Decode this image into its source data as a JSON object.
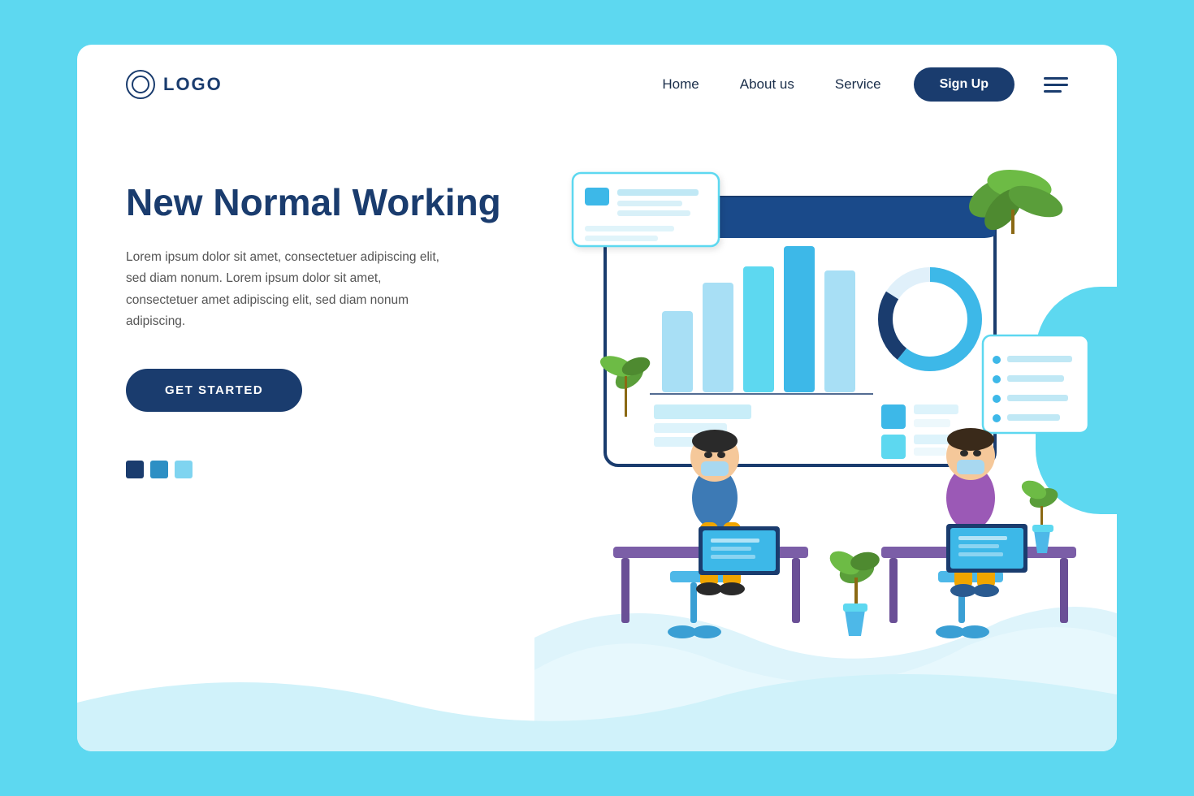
{
  "page": {
    "bg_color": "#5dd8f0",
    "card_bg": "#ffffff"
  },
  "navbar": {
    "logo_text": "LOGO",
    "links": [
      {
        "label": "Home",
        "id": "home"
      },
      {
        "label": "About us",
        "id": "about"
      },
      {
        "label": "Service",
        "id": "service"
      }
    ],
    "signup_label": "Sign Up",
    "hamburger_label": "menu"
  },
  "hero": {
    "title": "New Normal Working",
    "description": "Lorem ipsum dolor sit amet, consectetuer adipiscing elit, sed diam nonum. Lorem ipsum dolor sit amet, consectetuer amet adipiscing elit, sed diam nonum adipiscing.",
    "cta_label": "GET STARTED",
    "dots": [
      "dark",
      "mid",
      "light"
    ]
  },
  "colors": {
    "primary_dark": "#1a3c6e",
    "primary_mid": "#2d8fc4",
    "primary_light": "#7fd4f0",
    "accent_cyan": "#5dd8f0",
    "bg_light": "#e0f7fc",
    "green_leaf": "#5a9e3a",
    "purple": "#9b59b6",
    "yellow": "#f0a500",
    "gray_text": "#555555"
  }
}
